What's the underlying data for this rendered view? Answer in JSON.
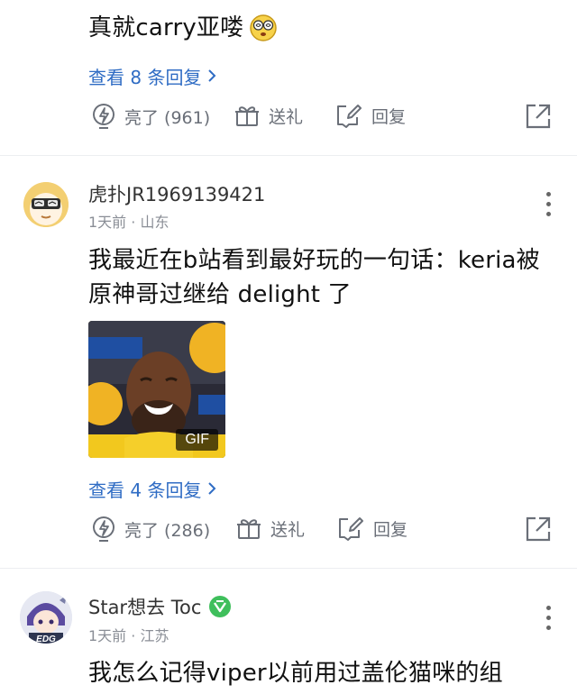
{
  "comment1": {
    "text": "真就carry亚喽",
    "view_replies": "查看 8 条回复",
    "actions": {
      "like": "亮了 (961)",
      "gift": "送礼",
      "reply": "回复"
    }
  },
  "comment2": {
    "username": "虎扑JR1969139421",
    "meta": "1天前 · 山东",
    "text_line1": "我最近在b站看到最好玩的一句话：keria被",
    "text_line2": "原神哥过继给 delight 了",
    "gif_badge": "GIF",
    "view_replies": "查看 4 条回复",
    "actions": {
      "like": "亮了 (286)",
      "gift": "送礼",
      "reply": "回复"
    }
  },
  "comment3": {
    "username": "Star想去 Toc",
    "meta": "1天前 · 江苏",
    "text": "我怎么记得viper以前用过盖伦猫咪的组",
    "avatar_badge": "EDG"
  },
  "colors": {
    "link": "#2f6cc4",
    "action": "#6a6f78",
    "meta": "#8a8e96",
    "divider": "#eceef1",
    "verified_badge": "#3fbf5c"
  }
}
